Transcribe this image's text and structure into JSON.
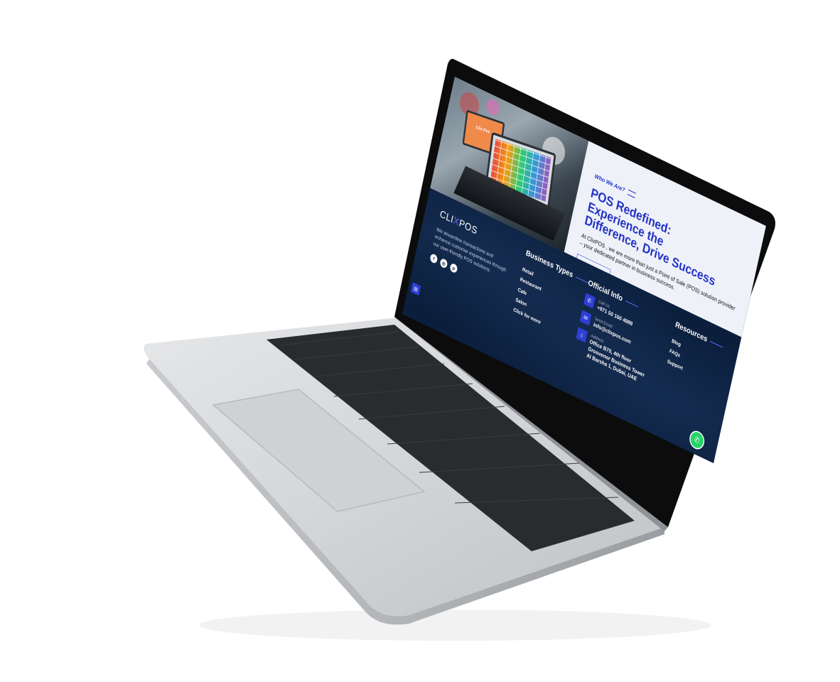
{
  "about": {
    "eyebrow": "Who We Are?",
    "title_line1": "POS Redefined:",
    "title_line2": "Experience the",
    "title_line3": "Difference, Drive Success",
    "body": "At ClixPOS , we are more than just a Point of Sale (POS) solution provider – your dedicated partner in business success.",
    "cta_label": "Contact Us",
    "terminal_screen_label": "Clix Pos"
  },
  "footer": {
    "logo_pre": "CLI",
    "logo_accent": "X",
    "logo_post": "POS",
    "description": "We streamline transactions and enhance customer experiences through our user-friendly POS solutions.",
    "socials": [
      {
        "icon": "facebook-icon",
        "glyph": "f"
      },
      {
        "icon": "instagram-icon",
        "glyph": "◎"
      },
      {
        "icon": "pinterest-icon",
        "glyph": "p"
      }
    ],
    "business_types": {
      "title": "Business Types",
      "items": [
        "Retail",
        "Restaurant",
        "Cafe",
        "Salon",
        "Click for more"
      ]
    },
    "official_info": {
      "title": "Official Info",
      "phone_label": "Call Us",
      "phone": "+971 50 160 4989",
      "email_label": "Send Email",
      "email": "info@clixpos.com",
      "address_label": "Address",
      "address": "Office B70, 4th floor Grosvenor Business Tower Al Barsha 1, Dubai, UAE"
    },
    "resources": {
      "title": "Resources",
      "items": [
        "Blog",
        "FAQs",
        "Support"
      ]
    }
  },
  "colors": {
    "accent": "#2332c7",
    "footer_bg": "#0b1f3d",
    "icon_bg": "#2f3fd6",
    "whatsapp": "#25d366"
  }
}
